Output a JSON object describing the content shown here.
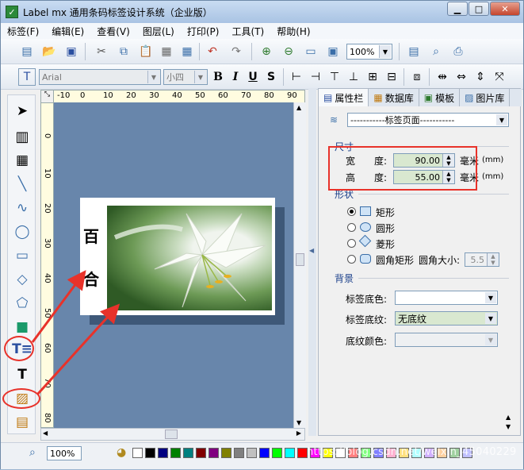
{
  "window": {
    "title": "Label mx 通用条码标签设计系统（企业版）",
    "minimize": "▁",
    "restore": "□",
    "close": "✕"
  },
  "menu": [
    "标签(F)",
    "编辑(E)",
    "查看(V)",
    "图层(L)",
    "打印(P)",
    "工具(T)",
    "帮助(H)"
  ],
  "toolbar1": {
    "zoom_value": "100%"
  },
  "toolbar2": {
    "font_name": "Arial",
    "font_size": "小四",
    "bold": "B",
    "italic": "I",
    "underline": "U",
    "strike": "S"
  },
  "ruler_h": [
    "-10",
    "0",
    "10",
    "20",
    "30",
    "40",
    "50",
    "60",
    "70",
    "80",
    "90"
  ],
  "ruler_v": [
    "0",
    "10",
    "20",
    "30",
    "40",
    "50",
    "60",
    "70",
    "80"
  ],
  "canvas": {
    "char1": "百",
    "char2": "合"
  },
  "panel": {
    "tabs": [
      "属性栏",
      "数据库",
      "模板",
      "图片库"
    ],
    "page_selector": "-----------标签页面-----------",
    "size_section": "尺寸",
    "width_label": "宽　　度:",
    "width_value": "90.00",
    "height_label": "高　　度:",
    "height_value": "55.00",
    "unit": "毫米",
    "unit_mm": "(mm)",
    "shape_section": "形状",
    "shapes": [
      "矩形",
      "圆形",
      "菱形",
      "圆角矩形"
    ],
    "corner_label": "圆角大小:",
    "corner_value": "5.5",
    "bg_section": "背景",
    "bg_color_label": "标签底色:",
    "bg_pattern_label": "标签底纹:",
    "bg_pattern_value": "无底纹",
    "pattern_color_label": "底纹颜色:"
  },
  "status": {
    "zoom": "100%"
  },
  "palette": [
    "#ffffff",
    "#000000",
    "#000080",
    "#008000",
    "#008080",
    "#800000",
    "#800080",
    "#808000",
    "#808080",
    "#c0c0c0",
    "#0000ff",
    "#00ff00",
    "#00ffff",
    "#ff0000",
    "#ff00ff",
    "#ffff00",
    "#ffffff",
    "#ff8080",
    "#80ff80",
    "#8080ff",
    "#ffb0d0",
    "#ffe080",
    "#b0ffff",
    "#d0b0ff",
    "#ffd0a0",
    "#a0d0a0",
    "#c0c0ff"
  ],
  "watermark": "https://blog.csdn.net/weixin_45040229",
  "colors": {
    "canvas": "#6886ab",
    "highlight": "#e8322a"
  }
}
